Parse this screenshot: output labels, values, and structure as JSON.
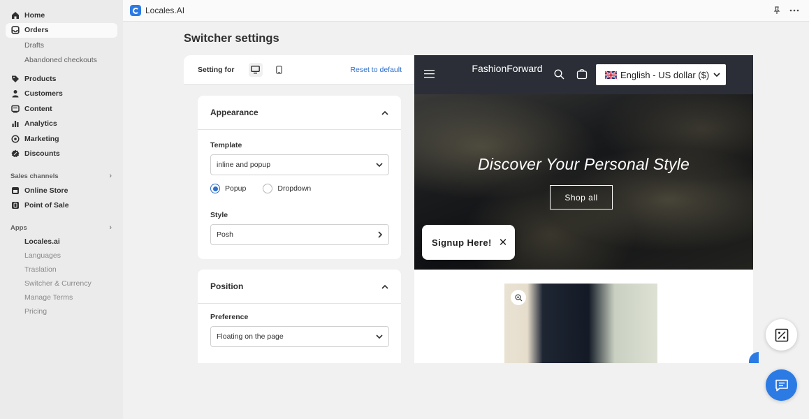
{
  "sidebar": {
    "main_items": [
      {
        "label": "Home",
        "icon": "home-icon"
      },
      {
        "label": "Orders",
        "icon": "orders-icon"
      }
    ],
    "order_subitems": [
      "Drafts",
      "Abandoned checkouts"
    ],
    "items": [
      {
        "label": "Products",
        "icon": "tag-icon"
      },
      {
        "label": "Customers",
        "icon": "person-icon"
      },
      {
        "label": "Content",
        "icon": "content-icon"
      },
      {
        "label": "Analytics",
        "icon": "analytics-icon"
      },
      {
        "label": "Marketing",
        "icon": "marketing-icon"
      },
      {
        "label": "Discounts",
        "icon": "discount-icon"
      }
    ],
    "sales_channels_label": "Sales channels",
    "sales_channels": [
      "Online Store",
      "Point of Sale"
    ],
    "apps_label": "Apps",
    "apps": [
      "Locales.ai",
      "Languages",
      "Traslation",
      "Switcher & Currency",
      "Manage Terms",
      "Pricing"
    ]
  },
  "topbar": {
    "app_title": "Locales.AI"
  },
  "page": {
    "title": "Switcher settings"
  },
  "settings": {
    "setting_for_label": "Setting for",
    "reset_label": "Reset to default",
    "appearance": {
      "title": "Appearance",
      "template_label": "Template",
      "template_value": "inline and popup",
      "radio_popup": "Popup",
      "radio_dropdown": "Dropdown",
      "style_label": "Style",
      "style_value": "Posh"
    },
    "position": {
      "title": "Position",
      "preference_label": "Preference",
      "preference_value": "Floating on the page"
    }
  },
  "preview": {
    "store_name": "FashionForward",
    "language_button": "English - US dollar ($)",
    "hero_title": "Discover Your Personal Style",
    "shop_button": "Shop all",
    "signup_text": "Signup Here!"
  },
  "colors": {
    "accent": "#2c7be5",
    "link": "#2c6ecb",
    "store_header": "#2b2e36"
  }
}
